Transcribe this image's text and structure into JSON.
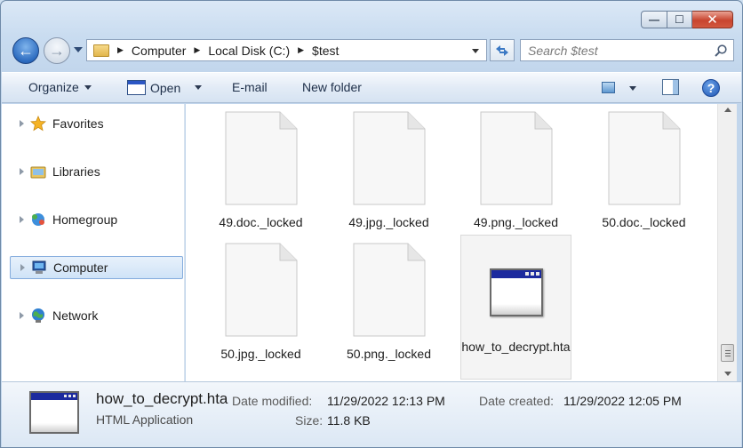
{
  "window": {
    "minimize_glyph": "—",
    "maximize_glyph": "☐",
    "close_glyph": "✕"
  },
  "nav": {
    "back_glyph": "←",
    "forward_glyph": "→"
  },
  "address": {
    "separator": "▶",
    "crumbs": [
      "Computer",
      "Local Disk (C:)",
      "$test"
    ]
  },
  "search": {
    "placeholder": "Search $test"
  },
  "toolbar": {
    "organize": "Organize",
    "open": "Open",
    "email": "E-mail",
    "new_folder": "New folder",
    "help_glyph": "?"
  },
  "sidebar": {
    "items": [
      {
        "label": "Favorites",
        "icon": "star-icon",
        "selected": false
      },
      {
        "label": "Libraries",
        "icon": "libraries-icon",
        "selected": false
      },
      {
        "label": "Homegroup",
        "icon": "homegroup-icon",
        "selected": false
      },
      {
        "label": "Computer",
        "icon": "computer-icon",
        "selected": true
      },
      {
        "label": "Network",
        "icon": "network-icon",
        "selected": false
      }
    ]
  },
  "files": [
    {
      "name": "49.doc._locked",
      "type": "document"
    },
    {
      "name": "49.jpg._locked",
      "type": "document"
    },
    {
      "name": "49.png._locked",
      "type": "document"
    },
    {
      "name": "50.doc._locked",
      "type": "document"
    },
    {
      "name": "50.jpg._locked",
      "type": "document"
    },
    {
      "name": "50.png._locked",
      "type": "document"
    },
    {
      "name": "how_to_decrypt.hta",
      "type": "hta",
      "selected": true
    }
  ],
  "details": {
    "name": "how_to_decrypt.hta",
    "type": "HTML Application",
    "modified_label": "Date modified:",
    "modified_value": "11/29/2022 12:13 PM",
    "created_label": "Date created:",
    "created_value": "11/29/2022 12:05 PM",
    "size_label": "Size:",
    "size_value": "11.8 KB"
  }
}
